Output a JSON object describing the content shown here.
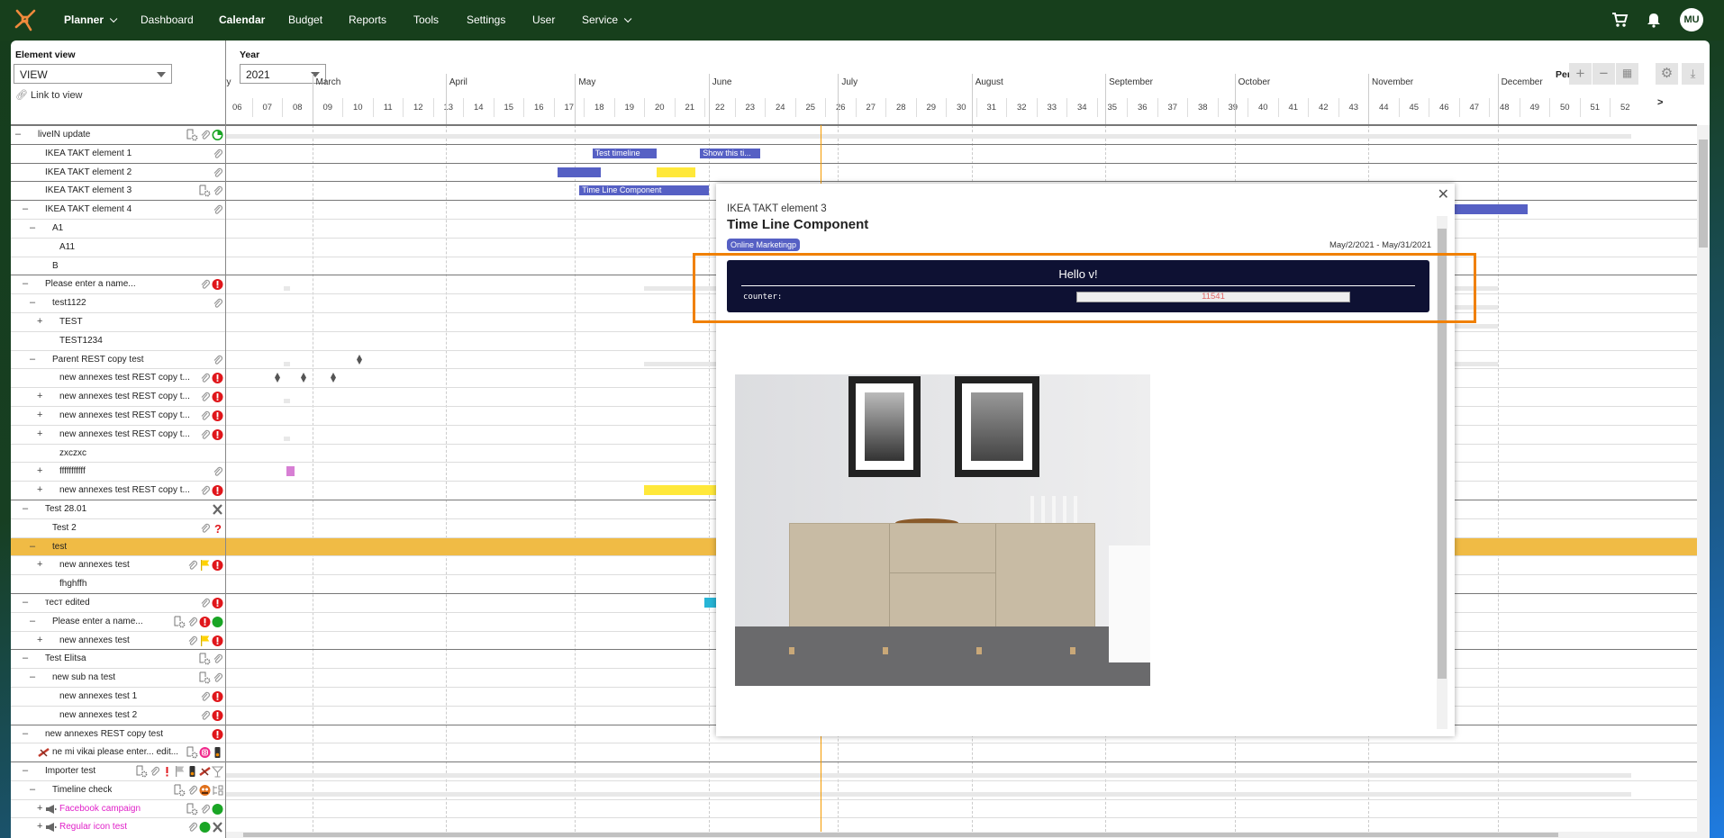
{
  "nav": {
    "items": [
      {
        "label": "Planner",
        "chevron": true,
        "bold": true
      },
      {
        "label": "Dashboard"
      },
      {
        "label": "Calendar",
        "bold": true
      },
      {
        "label": "Budget"
      },
      {
        "label": "Reports"
      },
      {
        "label": "Tools"
      },
      {
        "label": "Settings"
      },
      {
        "label": "User"
      },
      {
        "label": "Service",
        "chevron": true
      }
    ],
    "avatar": "MU"
  },
  "toolbar": {
    "element_view_label": "Element view",
    "element_view_value": "VIEW",
    "link_to_view": "Link to view",
    "year_label": "Year",
    "year_value": "2021",
    "period_label": "Period",
    "next_label": ">"
  },
  "timeline": {
    "months": [
      {
        "name": "February",
        "start": "2021-02-01"
      },
      {
        "name": "March",
        "start": "2021-03-01"
      },
      {
        "name": "April",
        "start": "2021-04-01"
      },
      {
        "name": "May",
        "start": "2021-05-01"
      },
      {
        "name": "June",
        "start": "2021-06-01"
      },
      {
        "name": "July",
        "start": "2021-07-01"
      },
      {
        "name": "August",
        "start": "2021-08-01"
      },
      {
        "name": "September",
        "start": "2021-09-01"
      },
      {
        "name": "October",
        "start": "2021-10-01"
      },
      {
        "name": "November",
        "start": "2021-11-01"
      },
      {
        "name": "December",
        "start": "2021-12-01"
      }
    ],
    "weeks": [
      "06",
      "07",
      "08",
      "09",
      "10",
      "11",
      "12",
      "13",
      "14",
      "15",
      "16",
      "17",
      "18",
      "19",
      "20",
      "21",
      "22",
      "23",
      "24",
      "25",
      "26",
      "27",
      "28",
      "29",
      "30",
      "31",
      "32",
      "33",
      "34",
      "35",
      "36",
      "37",
      "38",
      "39",
      "40",
      "41",
      "42",
      "43",
      "44",
      "45",
      "46",
      "47",
      "48",
      "49",
      "50",
      "51",
      "52"
    ],
    "today": "2021-06-27"
  },
  "colors": {
    "bar_blue": "#5660c4",
    "bar_yellow": "#ffe83a",
    "bar_cyan": "#27b5d6",
    "bar_pink": "#d77fd4",
    "highlight": "#f0bb45",
    "today": "#f59b00"
  },
  "rows": [
    {
      "label": "liveIN update",
      "level": 0,
      "expand": "–",
      "icons": [
        "doc-gear",
        "clip",
        "pie"
      ],
      "bars": [
        {
          "type": "summary",
          "start": "2021-02-01",
          "end": "2021-12-31"
        }
      ]
    },
    {
      "label": "IKEA TAKT element 1",
      "level": 1,
      "icons": [
        "clip"
      ],
      "bars": [
        {
          "type": "bar",
          "start": "2021-05-05",
          "end": "2021-05-19",
          "color": "bar_blue",
          "label": "Test timeline"
        },
        {
          "type": "bar",
          "start": "2021-05-30",
          "end": "2021-06-12",
          "color": "bar_blue",
          "label": "Show this ti..."
        }
      ]
    },
    {
      "label": "IKEA TAKT element 2",
      "level": 1,
      "icons": [
        "clip"
      ],
      "bars": [
        {
          "type": "bar",
          "start": "2021-04-27",
          "end": "2021-05-06",
          "color": "bar_blue"
        },
        {
          "type": "bar",
          "start": "2021-05-20",
          "end": "2021-05-28",
          "color": "bar_yellow"
        }
      ]
    },
    {
      "label": "IKEA TAKT element 3",
      "level": 1,
      "icons": [
        "doc-gear",
        "clip"
      ],
      "bars": [
        {
          "type": "bar",
          "start": "2021-05-02",
          "end": "2021-05-31",
          "color": "bar_blue",
          "label": "Time Line Component"
        }
      ]
    },
    {
      "label": "IKEA TAKT element 4",
      "level": 1,
      "expand": "–",
      "icons": [
        "clip"
      ],
      "bars": [
        {
          "type": "bar",
          "start": "2021-11-21",
          "end": "2021-12-07",
          "color": "bar_blue"
        }
      ]
    },
    {
      "label": "A1",
      "level": 2,
      "expand": "–",
      "icons": []
    },
    {
      "label": "A11",
      "level": 3,
      "icons": []
    },
    {
      "label": "B",
      "level": 2,
      "icons": []
    },
    {
      "label": "Please enter a name...",
      "level": 1,
      "expand": "–",
      "icons": [
        "clip",
        "alert"
      ],
      "bars": [
        {
          "type": "marker",
          "start": "2021-02-23"
        },
        {
          "type": "summary",
          "start": "2021-05-17",
          "end": "2021-11-30"
        }
      ]
    },
    {
      "label": "test1122",
      "level": 2,
      "expand": "–",
      "icons": [
        "clip"
      ],
      "bars": [
        {
          "type": "summary",
          "start": "2021-10-26",
          "end": "2021-11-30"
        }
      ]
    },
    {
      "label": "TEST",
      "level": 3,
      "expand": "+",
      "icons": [],
      "bars": [
        {
          "type": "summary",
          "start": "2021-10-26",
          "end": "2021-11-30"
        }
      ]
    },
    {
      "label": "TEST1234",
      "level": 3,
      "icons": []
    },
    {
      "label": "Parent REST copy test",
      "level": 2,
      "expand": "–",
      "icons": [
        "clip"
      ],
      "bars": [
        {
          "type": "marker",
          "start": "2021-02-23"
        },
        {
          "type": "milestone",
          "start": "2021-03-12"
        },
        {
          "type": "summary",
          "start": "2021-05-17",
          "end": "2021-11-30"
        }
      ]
    },
    {
      "label": "new annexes test REST copy t...",
      "level": 3,
      "icons": [
        "clip",
        "alert"
      ],
      "bars": [
        {
          "type": "milestone",
          "start": "2021-02-21"
        },
        {
          "type": "milestone",
          "start": "2021-02-27"
        },
        {
          "type": "milestone",
          "start": "2021-03-06"
        }
      ]
    },
    {
      "label": "new annexes test REST copy t...",
      "level": 3,
      "expand": "+",
      "icons": [
        "clip",
        "alert"
      ],
      "bars": [
        {
          "type": "marker",
          "start": "2021-02-23"
        }
      ]
    },
    {
      "label": "new annexes test REST copy t...",
      "level": 3,
      "expand": "+",
      "icons": [
        "clip",
        "alert"
      ]
    },
    {
      "label": "new annexes test REST copy t...",
      "level": 3,
      "expand": "+",
      "icons": [
        "clip",
        "alert"
      ],
      "bars": [
        {
          "type": "marker",
          "start": "2021-02-23"
        }
      ]
    },
    {
      "label": "zxczxc",
      "level": 3,
      "icons": []
    },
    {
      "label": "fffffffffff",
      "level": 3,
      "expand": "+",
      "icons": [
        "clip"
      ],
      "bars": [
        {
          "type": "bar",
          "start": "2021-02-23",
          "end": "2021-02-24",
          "color": "bar_pink"
        }
      ]
    },
    {
      "label": "new annexes test REST copy t...",
      "level": 3,
      "expand": "+",
      "icons": [
        "clip",
        "alert"
      ],
      "bars": [
        {
          "type": "bar",
          "start": "2021-05-17",
          "end": "2021-06-02",
          "color": "bar_yellow"
        }
      ]
    },
    {
      "label": "Test 28.01",
      "level": 1,
      "expand": "–",
      "icons": [
        "tools"
      ]
    },
    {
      "label": "Test 2",
      "level": 2,
      "icons": [
        "clip",
        "question"
      ]
    },
    {
      "label": "test",
      "level": 2,
      "expand": "–",
      "icons": [],
      "highlight": true
    },
    {
      "label": "new annexes test",
      "level": 3,
      "expand": "+",
      "icons": [
        "clip",
        "flag",
        "alert"
      ]
    },
    {
      "label": "fhghffh",
      "level": 3,
      "icons": []
    },
    {
      "label": "тест edited",
      "level": 1,
      "expand": "–",
      "icons": [
        "clip",
        "alert"
      ],
      "bars": [
        {
          "type": "bar",
          "start": "2021-05-31",
          "end": "2021-06-02",
          "color": "bar_cyan"
        }
      ]
    },
    {
      "label": "Please enter a name...",
      "level": 2,
      "expand": "–",
      "icons": [
        "doc-gear",
        "clip",
        "alert",
        "green"
      ]
    },
    {
      "label": "new annexes test",
      "level": 3,
      "expand": "+",
      "icons": [
        "clip",
        "flag",
        "alert"
      ]
    },
    {
      "label": "Test Elitsa",
      "level": 1,
      "expand": "–",
      "icons": [
        "doc-gear",
        "clip"
      ]
    },
    {
      "label": "new sub na test",
      "level": 2,
      "expand": "–",
      "icons": [
        "doc-gear",
        "clip"
      ]
    },
    {
      "label": "new annexes test 1",
      "level": 3,
      "icons": [
        "clip",
        "alert"
      ]
    },
    {
      "label": "new annexes test 2",
      "level": 3,
      "icons": [
        "clip",
        "alert"
      ]
    },
    {
      "label": "new annexes REST copy test",
      "level": 1,
      "expand": "–",
      "icons": [
        "alert"
      ]
    },
    {
      "label": "ne mi vikai please enter... edit...",
      "level": 2,
      "lead_icon": "satellite",
      "icons": [
        "doc-gear",
        "instagram",
        "traffic"
      ]
    },
    {
      "label": "Importer test",
      "level": 1,
      "expand": "–",
      "icons": [
        "doc-gear",
        "clip",
        "exclaim",
        "flag-grey",
        "traffic",
        "satellite",
        "cocktail"
      ],
      "bars": [
        {
          "type": "summary",
          "start": "2021-02-01",
          "end": "2021-12-31"
        }
      ]
    },
    {
      "label": "Timeline check",
      "level": 2,
      "expand": "–",
      "icons": [
        "doc-gear",
        "clip",
        "bug",
        "hierarchy"
      ],
      "bars": [
        {
          "type": "summary",
          "start": "2021-02-01",
          "end": "2021-12-31"
        }
      ]
    },
    {
      "label": "Facebook campaign",
      "level": 3,
      "expand": "+",
      "lead_icon": "megaphone",
      "pink": true,
      "icons": [
        "doc-gear",
        "clip",
        "green"
      ]
    },
    {
      "label": "Regular icon test",
      "level": 3,
      "expand": "+",
      "lead_icon": "megaphone",
      "pink": true,
      "icons": [
        "clip",
        "green",
        "tools"
      ]
    }
  ],
  "modal": {
    "parent": "IKEA TAKT element 3",
    "title": "Time Line Component",
    "badge": "Online Marketingp",
    "dates": "May/2/2021 - May/31/2021",
    "widget": {
      "greeting": "Hello v!",
      "counter_label": "counter:",
      "counter_value": "11541"
    }
  }
}
